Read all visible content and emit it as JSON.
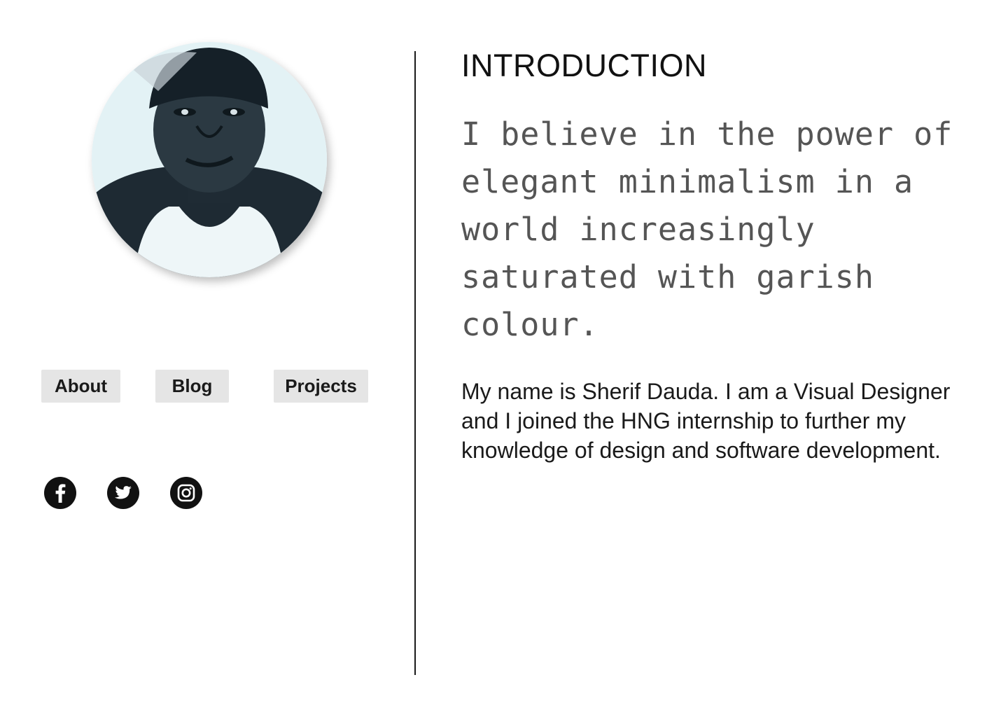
{
  "profile": {
    "avatar_icon": "profile-photo"
  },
  "nav": {
    "about_label": "About",
    "blog_label": "Blog",
    "projects_label": "Projects"
  },
  "social": [
    {
      "icon": "facebook-icon"
    },
    {
      "icon": "twitter-icon"
    },
    {
      "icon": "instagram-icon"
    }
  ],
  "intro": {
    "heading": "INTRODUCTION",
    "quote": "I believe in the power of elegant minimalism in a world increasingly saturated with garish colour.",
    "bio": "My name is Sherif Dauda. I am a Visual Designer and I joined the HNG internship to further my knowledge of design and software development."
  },
  "colors": {
    "button_bg": "#e5e5e5",
    "icon_bg": "#111111",
    "quote_text": "#555555"
  }
}
